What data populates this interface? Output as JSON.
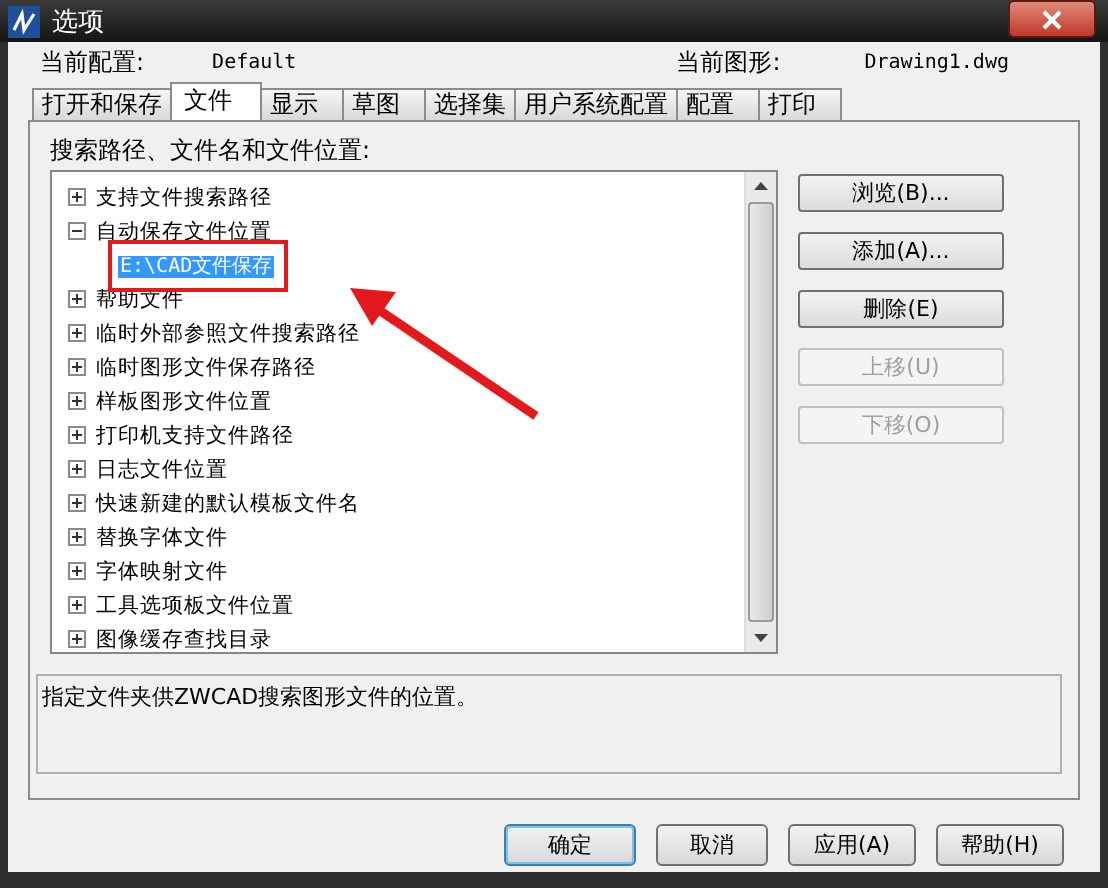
{
  "window": {
    "title": "选项"
  },
  "profile": {
    "label": "当前配置:",
    "value": "Default"
  },
  "drawing": {
    "label": "当前图形:",
    "value": "Drawing1.dwg"
  },
  "tabs": [
    {
      "label": "打开和保存",
      "selected": false
    },
    {
      "label": "文件",
      "selected": true
    },
    {
      "label": "显示",
      "selected": false
    },
    {
      "label": "草图",
      "selected": false
    },
    {
      "label": "选择集",
      "selected": false
    },
    {
      "label": "用户系统配置",
      "selected": false
    },
    {
      "label": "配置",
      "selected": false
    },
    {
      "label": "打印",
      "selected": false
    }
  ],
  "tree": {
    "label": "搜索路径、文件名和文件位置:",
    "items": [
      {
        "label": "支持文件搜索路径",
        "expanded": false
      },
      {
        "label": "自动保存文件位置",
        "expanded": true,
        "children": [
          {
            "label": "E:\\CAD文件保存",
            "selected": true
          }
        ]
      },
      {
        "label": "帮助文件",
        "expanded": false
      },
      {
        "label": "临时外部参照文件搜索路径",
        "expanded": false
      },
      {
        "label": "临时图形文件保存路径",
        "expanded": false
      },
      {
        "label": "样板图形文件位置",
        "expanded": false
      },
      {
        "label": "打印机支持文件路径",
        "expanded": false
      },
      {
        "label": "日志文件位置",
        "expanded": false
      },
      {
        "label": "快速新建的默认模板文件名",
        "expanded": false
      },
      {
        "label": "替换字体文件",
        "expanded": false
      },
      {
        "label": "字体映射文件",
        "expanded": false
      },
      {
        "label": "工具选项板文件位置",
        "expanded": false
      },
      {
        "label": "图像缓存查找目录",
        "expanded": false
      }
    ]
  },
  "side_buttons": [
    {
      "label": "浏览(B)...",
      "disabled": false
    },
    {
      "label": "添加(A)...",
      "disabled": false
    },
    {
      "label": "删除(E)",
      "disabled": false
    },
    {
      "label": "上移(U)",
      "disabled": true
    },
    {
      "label": "下移(O)",
      "disabled": true
    }
  ],
  "description": "指定文件夹供ZWCAD搜索图形文件的位置。",
  "footer_buttons": [
    {
      "label": "确定",
      "default": true
    },
    {
      "label": "取消",
      "default": false
    },
    {
      "label": "应用(A)",
      "default": false
    },
    {
      "label": "帮助(H)",
      "default": false
    }
  ]
}
